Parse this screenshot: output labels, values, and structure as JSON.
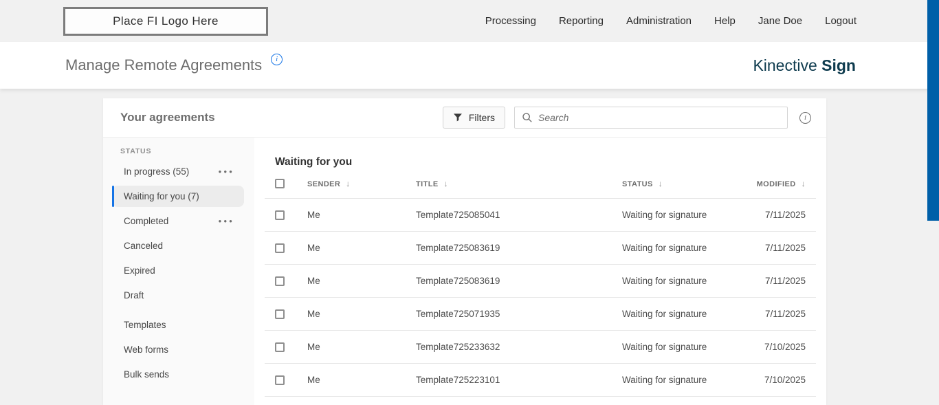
{
  "topbar": {
    "logo_text": "Place FI Logo Here",
    "nav": [
      "Processing",
      "Reporting",
      "Administration",
      "Help",
      "Jane Doe",
      "Logout"
    ]
  },
  "page_header": {
    "title": "Manage Remote Agreements",
    "info_icon": "i",
    "brand_name": "Kinective",
    "brand_product": "Sign"
  },
  "panel": {
    "title": "Your agreements",
    "filters_label": "Filters",
    "search_placeholder": "Search",
    "info_icon": "i"
  },
  "sidebar": {
    "section_label": "STATUS",
    "status_items": [
      {
        "label": "In progress (55)",
        "has_menu": true,
        "selected": false
      },
      {
        "label": "Waiting for you (7)",
        "has_menu": false,
        "selected": true
      },
      {
        "label": "Completed",
        "has_menu": true,
        "selected": false
      },
      {
        "label": "Canceled",
        "has_menu": false,
        "selected": false
      },
      {
        "label": "Expired",
        "has_menu": false,
        "selected": false
      },
      {
        "label": "Draft",
        "has_menu": false,
        "selected": false
      }
    ],
    "other_items": [
      {
        "label": "Templates"
      },
      {
        "label": "Web forms"
      },
      {
        "label": "Bulk sends"
      }
    ]
  },
  "table": {
    "title": "Waiting for you",
    "columns": [
      "SENDER",
      "TITLE",
      "STATUS",
      "MODIFIED"
    ],
    "rows": [
      {
        "sender": "Me",
        "title": "Template725085041",
        "status": "Waiting for signature",
        "modified": "7/11/2025"
      },
      {
        "sender": "Me",
        "title": "Template725083619",
        "status": "Waiting for signature",
        "modified": "7/11/2025"
      },
      {
        "sender": "Me",
        "title": "Template725083619",
        "status": "Waiting for signature",
        "modified": "7/11/2025"
      },
      {
        "sender": "Me",
        "title": "Template725071935",
        "status": "Waiting for signature",
        "modified": "7/11/2025"
      },
      {
        "sender": "Me",
        "title": "Template725233632",
        "status": "Waiting for signature",
        "modified": "7/10/2025"
      },
      {
        "sender": "Me",
        "title": "Template725223101",
        "status": "Waiting for signature",
        "modified": "7/10/2025"
      }
    ]
  },
  "icons": {
    "sort_desc": "↓",
    "ellipsis": "●●●"
  },
  "colors": {
    "accent_blue": "#1473e6",
    "brand_teal": "#0e3b4e",
    "right_strip_blue": "#005fa8"
  }
}
